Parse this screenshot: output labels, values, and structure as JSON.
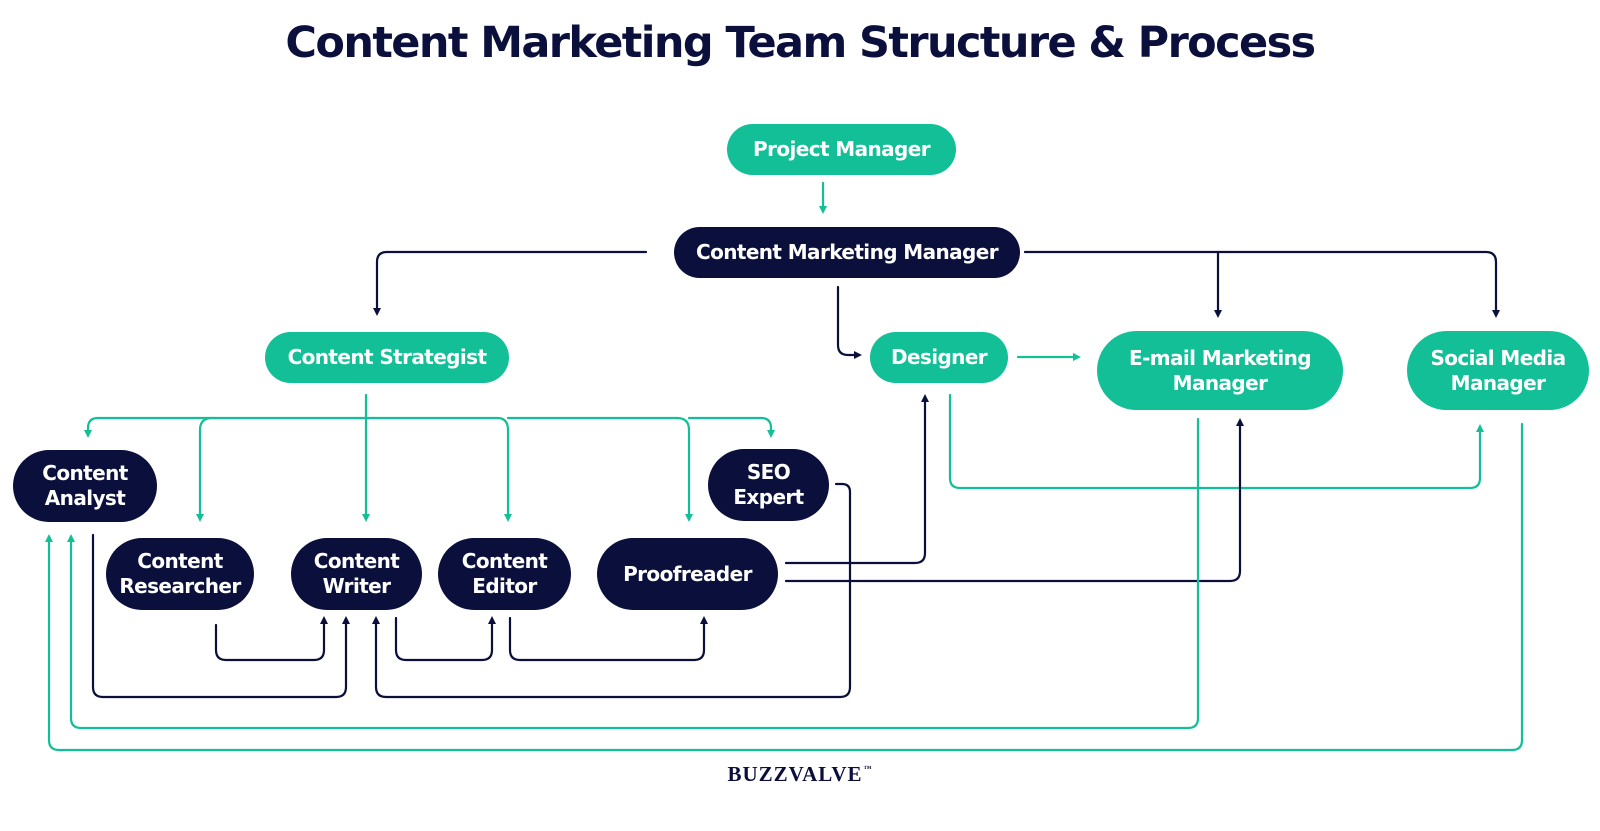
{
  "title": "Content Marketing Team Structure & Process",
  "brand": {
    "name": "BUZZVALVE",
    "trademark": "™"
  },
  "colors": {
    "accent_green": "#12bf96",
    "navy": "#0a0f3c",
    "background": "#ffffff"
  },
  "nodes": {
    "project_manager": {
      "label": "Project Manager",
      "color": "green"
    },
    "content_marketing_manager": {
      "label": "Content Marketing Manager",
      "color": "navy"
    },
    "content_strategist": {
      "label": "Content Strategist",
      "color": "green"
    },
    "designer": {
      "label": "Designer",
      "color": "green"
    },
    "email_marketing_manager": {
      "label": "E-mail Marketing\nManager",
      "color": "green"
    },
    "social_media_manager": {
      "label": "Social Media\nManager",
      "color": "green"
    },
    "content_analyst": {
      "label": "Content\nAnalyst",
      "color": "navy"
    },
    "seo_expert": {
      "label": "SEO\nExpert",
      "color": "navy"
    },
    "content_researcher": {
      "label": "Content\nResearcher",
      "color": "navy"
    },
    "content_writer": {
      "label": "Content\nWriter",
      "color": "navy"
    },
    "content_editor": {
      "label": "Content\nEditor",
      "color": "navy"
    },
    "proofreader": {
      "label": "Proofreader",
      "color": "navy"
    }
  },
  "edges": [
    {
      "from": "Project Manager",
      "to": "Content Marketing Manager",
      "color": "green"
    },
    {
      "from": "Content Marketing Manager",
      "to": "Content Strategist",
      "color": "navy"
    },
    {
      "from": "Content Marketing Manager",
      "to": "Designer",
      "color": "navy"
    },
    {
      "from": "Content Marketing Manager",
      "to": "E-mail Marketing Manager",
      "color": "navy"
    },
    {
      "from": "Content Marketing Manager",
      "to": "Social Media Manager",
      "color": "navy"
    },
    {
      "from": "Content Strategist",
      "to": "Content Analyst",
      "color": "green"
    },
    {
      "from": "Content Strategist",
      "to": "Content Researcher",
      "color": "green"
    },
    {
      "from": "Content Strategist",
      "to": "Content Writer",
      "color": "green"
    },
    {
      "from": "Content Strategist",
      "to": "Content Editor",
      "color": "green"
    },
    {
      "from": "Content Strategist",
      "to": "Proofreader",
      "color": "green"
    },
    {
      "from": "Content Strategist",
      "to": "SEO Expert",
      "color": "green"
    },
    {
      "from": "Designer",
      "to": "E-mail Marketing Manager",
      "color": "green"
    },
    {
      "from": "Designer",
      "to": "Social Media Manager",
      "color": "green"
    },
    {
      "from": "Content Researcher",
      "to": "Content Writer",
      "color": "navy"
    },
    {
      "from": "Content Analyst",
      "to": "Content Writer",
      "color": "navy"
    },
    {
      "from": "SEO Expert",
      "to": "Content Writer",
      "color": "navy"
    },
    {
      "from": "Content Writer",
      "to": "Content Editor",
      "color": "navy"
    },
    {
      "from": "Content Editor",
      "to": "Proofreader",
      "color": "navy"
    },
    {
      "from": "Proofreader",
      "to": "Designer",
      "color": "navy"
    },
    {
      "from": "Proofreader",
      "to": "E-mail Marketing Manager",
      "color": "navy"
    },
    {
      "from": "E-mail Marketing Manager",
      "to": "Content Analyst",
      "color": "green"
    },
    {
      "from": "Social Media Manager",
      "to": "Content Analyst",
      "color": "green"
    }
  ]
}
